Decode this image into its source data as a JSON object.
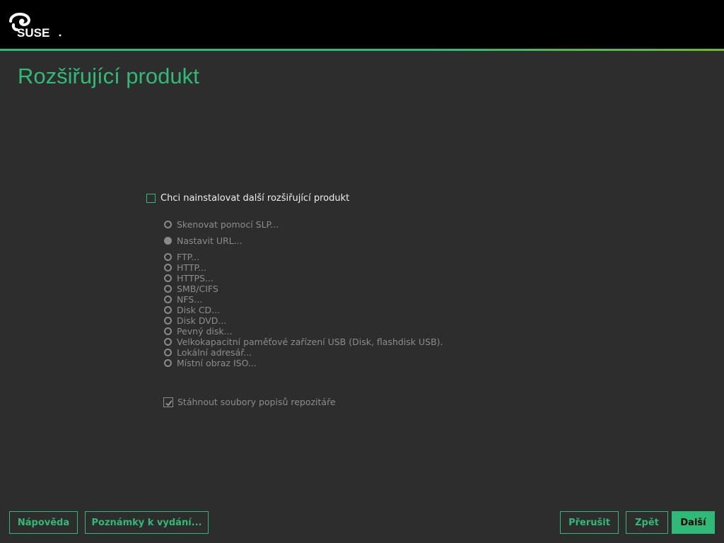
{
  "header": {
    "logo_text": "SUSE",
    "colors": {
      "bar": "#000000",
      "accent": "#30ba78",
      "accent_end": "#73ba25"
    }
  },
  "page": {
    "title": "Rozšiřující produkt",
    "main_checkbox": {
      "label": "Chci nainstalovat další rozšiřující produkt",
      "checked": false
    },
    "options": [
      {
        "label": "Skenovat pomocí SLP...",
        "selected": false
      },
      {
        "label": "Nastavit URL...",
        "selected": true
      },
      {
        "label": "FTP...",
        "selected": false
      },
      {
        "label": "HTTP...",
        "selected": false
      },
      {
        "label": "HTTPS...",
        "selected": false
      },
      {
        "label": "SMB/CIFS",
        "selected": false
      },
      {
        "label": "NFS...",
        "selected": false
      },
      {
        "label": "Disk CD...",
        "selected": false
      },
      {
        "label": "Disk DVD...",
        "selected": false
      },
      {
        "label": "Pevný disk...",
        "selected": false
      },
      {
        "label": "Velkokapacitní paměťové zařízení USB (Disk, flashdisk USB).",
        "selected": false
      },
      {
        "label": "Lokální adresář...",
        "selected": false
      },
      {
        "label": "Místní obraz ISO...",
        "selected": false
      }
    ],
    "download_checkbox": {
      "label": "Stáhnout soubory popisů repozitáře",
      "checked": true
    }
  },
  "footer": {
    "help_label": "Nápověda",
    "release_notes_label": "Poznámky k vydání...",
    "abort_label": "Přerušit",
    "back_label": "Zpět",
    "next_label": "Další"
  }
}
